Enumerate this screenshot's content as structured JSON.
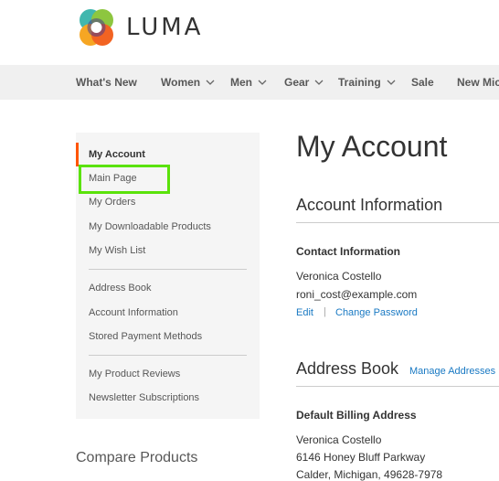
{
  "brand": {
    "name": "LUMA"
  },
  "nav": {
    "items": [
      {
        "label": "What's New",
        "has_dropdown": false
      },
      {
        "label": "Women",
        "has_dropdown": true
      },
      {
        "label": "Men",
        "has_dropdown": true
      },
      {
        "label": "Gear",
        "has_dropdown": true
      },
      {
        "label": "Training",
        "has_dropdown": true
      },
      {
        "label": "Sale",
        "has_dropdown": false
      },
      {
        "label": "New Mic",
        "has_dropdown": false
      }
    ]
  },
  "sidebar": {
    "active": "My Account",
    "groups": [
      [
        "My Account",
        "Main Page",
        "My Orders",
        "My Downloadable Products",
        "My Wish List"
      ],
      [
        "Address Book",
        "Account Information",
        "Stored Payment Methods"
      ],
      [
        "My Product Reviews",
        "Newsletter Subscriptions"
      ]
    ],
    "compare_title": "Compare Products"
  },
  "main": {
    "title": "My Account",
    "account_info": {
      "section_title": "Account Information",
      "contact_title": "Contact Information",
      "name": "Veronica Costello",
      "email": "roni_cost@example.com",
      "edit_label": "Edit",
      "separator": "|",
      "change_password_label": "Change Password"
    },
    "address_book": {
      "section_title": "Address Book",
      "manage_label": "Manage Addresses",
      "billing_title": "Default Billing Address",
      "name": "Veronica Costello",
      "street": "6146 Honey Bluff Parkway",
      "city_line": "Calder, Michigan, 49628-7978"
    }
  },
  "colors": {
    "accent": "#ff5501",
    "link": "#1979c3",
    "highlight": "#5ae20a"
  }
}
